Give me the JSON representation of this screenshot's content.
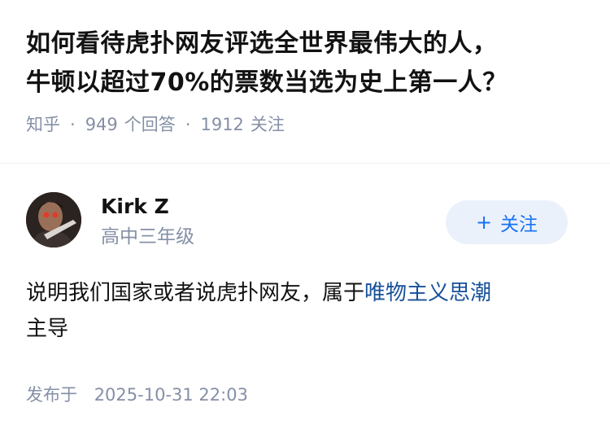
{
  "question": {
    "title_line1": "如何看待虎扑网友评选全世界最伟大的人，",
    "title_line2": "牛顿以超过70%的票数当选为史上第一人？",
    "source": "知乎",
    "answers_count": "949",
    "answers_label": "个回答",
    "followers_count": "1912",
    "followers_label": "关注"
  },
  "author": {
    "name": "Kirk Z",
    "headline": "高中三年级",
    "follow_label": "关注",
    "follow_icon": "plus-icon"
  },
  "answer": {
    "text_before": "说明我们国家或者说虎扑网友，属于",
    "link_text": "唯物主义思潮",
    "text_after": "主导"
  },
  "footer": {
    "published_label": "发布于",
    "published_time": "2025-10-31 22:03"
  },
  "colors": {
    "title": "#121212",
    "meta": "#8590a6",
    "link": "#175199",
    "accent": "#1772f6",
    "follow_bg": "#ebf1fb"
  }
}
